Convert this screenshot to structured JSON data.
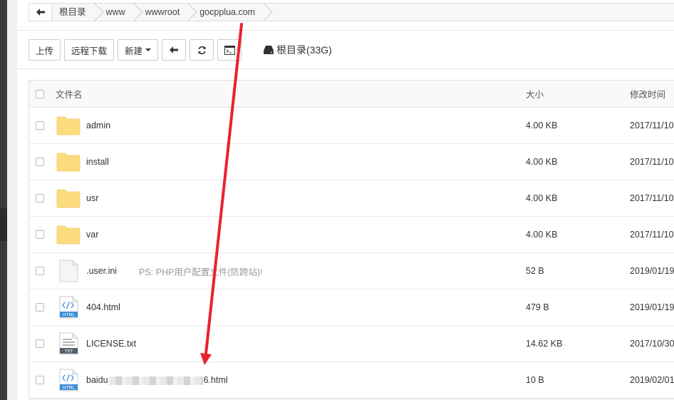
{
  "breadcrumb": {
    "back_icon": "arrow-left-icon",
    "items": [
      {
        "label": "根目录"
      },
      {
        "label": "www"
      },
      {
        "label": "wwwroot"
      },
      {
        "label": "gocpplua.com"
      }
    ]
  },
  "toolbar": {
    "upload_label": "上传",
    "remote_download_label": "远程下载",
    "new_label": "新建",
    "back_icon": "arrow-left-icon",
    "refresh_icon": "refresh-icon",
    "terminal_icon": "terminal-icon",
    "disk_icon": "hdd-icon",
    "disk_label": "根目录(33G)"
  },
  "table": {
    "headers": {
      "name": "文件名",
      "size": "大小",
      "modified": "修改时间"
    },
    "rows": [
      {
        "name": "admin",
        "icon": "folder-icon",
        "size": "4.00 KB",
        "modified": "2017/11/10"
      },
      {
        "name": "install",
        "icon": "folder-icon",
        "size": "4.00 KB",
        "modified": "2017/11/10"
      },
      {
        "name": "usr",
        "icon": "folder-icon",
        "size": "4.00 KB",
        "modified": "2017/11/10"
      },
      {
        "name": "var",
        "icon": "folder-icon",
        "size": "4.00 KB",
        "modified": "2017/11/10"
      },
      {
        "name": ".user.ini",
        "icon": "file-icon",
        "note": "PS: PHP用户配置文件(防跨站)!",
        "size": "52 B",
        "modified": "2019/01/19"
      },
      {
        "name": "404.html",
        "icon": "html-file-icon",
        "size": "479 B",
        "modified": "2019/01/19"
      },
      {
        "name": "LICENSE.txt",
        "icon": "txt-file-icon",
        "size": "14.62 KB",
        "modified": "2017/10/30"
      },
      {
        "name_prefix": "baidu",
        "name_suffix": "6.html",
        "icon": "html-file-icon",
        "size": "10 B",
        "modified": "2019/02/01"
      }
    ]
  },
  "colors": {
    "annotation_arrow": "#e8232d",
    "folder": "#fbdc7e"
  }
}
